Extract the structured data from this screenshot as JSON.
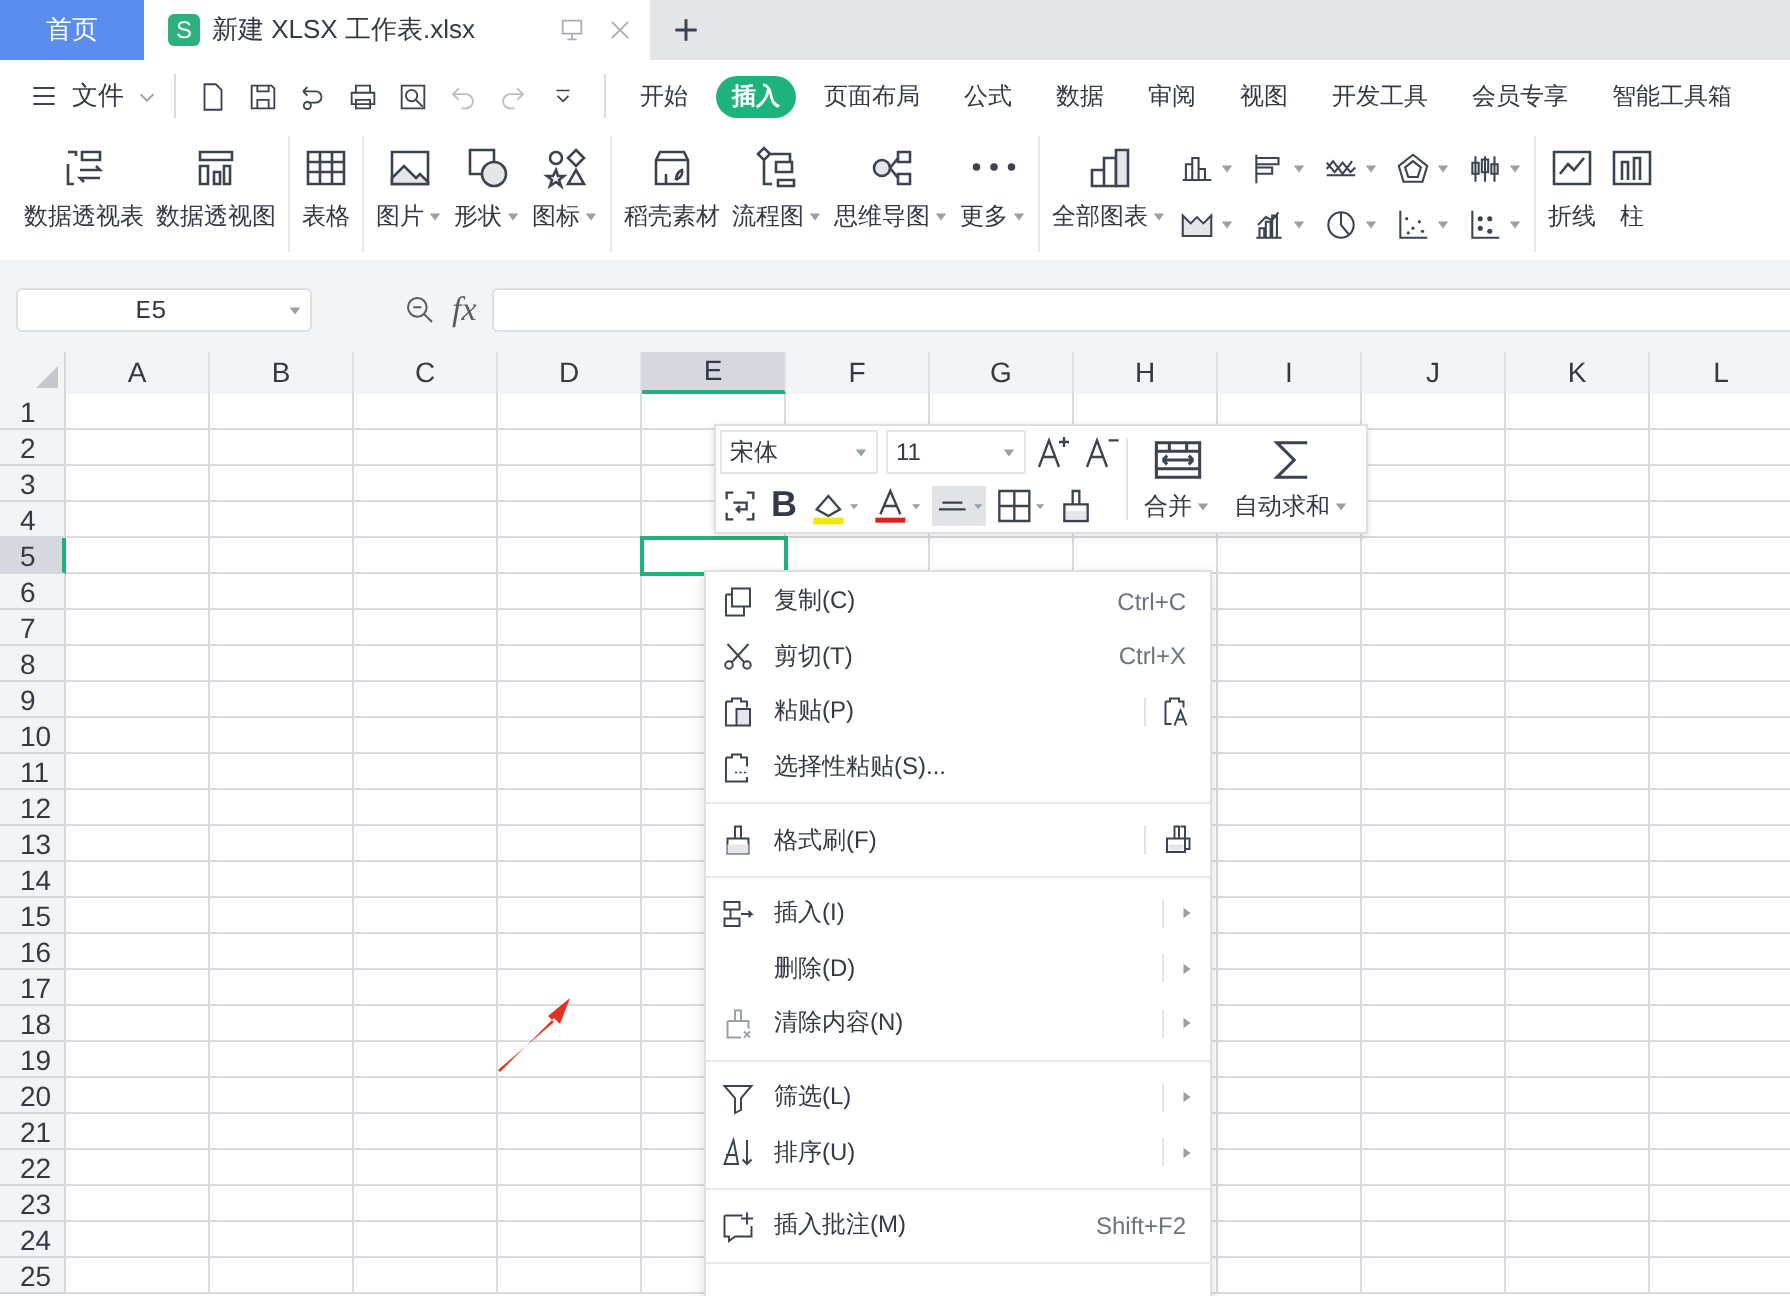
{
  "tabs": [
    {
      "kind": "home",
      "label": "首页",
      "selected": false
    },
    {
      "kind": "doc",
      "badge": "S",
      "label": "新建 XLSX 工作表.xlsx",
      "selected": true
    }
  ],
  "menu_bar": {
    "file_label": "文件",
    "quick_access": [
      {
        "disabled": false
      },
      {
        "disabled": false
      },
      {
        "disabled": false
      },
      {
        "disabled": false
      },
      {
        "disabled": false
      },
      {
        "disabled": true
      },
      {
        "disabled": true
      }
    ],
    "tabs": [
      {
        "label": "开始",
        "selected": false
      },
      {
        "label": "插入",
        "selected": true
      },
      {
        "label": "页面布局",
        "selected": false
      },
      {
        "label": "公式",
        "selected": false
      },
      {
        "label": "数据",
        "selected": false
      },
      {
        "label": "审阅",
        "selected": false
      },
      {
        "label": "视图",
        "selected": false
      },
      {
        "label": "开发工具",
        "selected": false
      },
      {
        "label": "会员专享",
        "selected": false
      },
      {
        "label": "智能工具箱",
        "selected": false
      }
    ]
  },
  "ribbon": {
    "groups": [
      {
        "items": [
          {
            "kind": "big",
            "label": "数据透视表",
            "dropdown": false
          },
          {
            "kind": "big",
            "label": "数据透视图",
            "dropdown": false
          }
        ]
      },
      {
        "items": [
          {
            "kind": "big",
            "label": "表格",
            "dropdown": false
          }
        ]
      },
      {
        "items": [
          {
            "kind": "big",
            "label": "图片",
            "dropdown": true
          },
          {
            "kind": "big",
            "label": "形状",
            "dropdown": true
          },
          {
            "kind": "big",
            "label": "图标",
            "dropdown": true
          }
        ]
      },
      {
        "items": [
          {
            "kind": "big",
            "label": "稻壳素材",
            "dropdown": false
          },
          {
            "kind": "big",
            "label": "流程图",
            "dropdown": true
          },
          {
            "kind": "big",
            "label": "思维导图",
            "dropdown": true
          },
          {
            "kind": "big",
            "label": "更多",
            "dropdown": true
          }
        ]
      },
      {
        "items": [
          {
            "kind": "big",
            "label": "全部图表",
            "dropdown": true
          },
          {
            "kind": "small",
            "dropdown": true
          },
          {
            "kind": "small",
            "dropdown": true
          },
          {
            "kind": "small",
            "dropdown": true
          },
          {
            "kind": "small",
            "dropdown": true
          },
          {
            "kind": "small",
            "dropdown": true
          },
          {
            "kind": "small",
            "dropdown": true
          },
          {
            "kind": "small",
            "dropdown": true
          },
          {
            "kind": "small",
            "dropdown": true
          },
          {
            "kind": "small",
            "dropdown": true
          },
          {
            "kind": "small",
            "dropdown": true
          }
        ]
      },
      {
        "items": [
          {
            "kind": "big",
            "label": "折线",
            "dropdown": false
          },
          {
            "kind": "big",
            "label": "柱",
            "dropdown": false
          }
        ]
      }
    ]
  },
  "formula_bar": {
    "name_box": "E5",
    "fx": "fx"
  },
  "sheet": {
    "columns": [
      {
        "label": "A",
        "selected": false
      },
      {
        "label": "B",
        "selected": false
      },
      {
        "label": "C",
        "selected": false
      },
      {
        "label": "D",
        "selected": false
      },
      {
        "label": "E",
        "selected": true
      },
      {
        "label": "F",
        "selected": false
      },
      {
        "label": "G",
        "selected": false
      },
      {
        "label": "H",
        "selected": false
      },
      {
        "label": "I",
        "selected": false
      },
      {
        "label": "J",
        "selected": false
      },
      {
        "label": "K",
        "selected": false
      },
      {
        "label": "L",
        "selected": false
      }
    ],
    "rows": [
      {
        "label": "1",
        "selected": false
      },
      {
        "label": "2",
        "selected": false
      },
      {
        "label": "3",
        "selected": false
      },
      {
        "label": "4",
        "selected": false
      },
      {
        "label": "5",
        "selected": true
      },
      {
        "label": "6",
        "selected": false
      },
      {
        "label": "7",
        "selected": false
      },
      {
        "label": "8",
        "selected": false
      },
      {
        "label": "9",
        "selected": false
      },
      {
        "label": "10",
        "selected": false
      },
      {
        "label": "11",
        "selected": false
      },
      {
        "label": "12",
        "selected": false
      },
      {
        "label": "13",
        "selected": false
      },
      {
        "label": "14",
        "selected": false
      },
      {
        "label": "15",
        "selected": false
      },
      {
        "label": "16",
        "selected": false
      },
      {
        "label": "17",
        "selected": false
      },
      {
        "label": "18",
        "selected": false
      },
      {
        "label": "19",
        "selected": false
      },
      {
        "label": "20",
        "selected": false
      },
      {
        "label": "21",
        "selected": false
      },
      {
        "label": "22",
        "selected": false
      },
      {
        "label": "23",
        "selected": false
      },
      {
        "label": "24",
        "selected": false
      },
      {
        "label": "25",
        "selected": false
      }
    ]
  },
  "mini_toolbar": {
    "font": "宋体",
    "size": "11",
    "bold": "B",
    "align_selected": true,
    "merge": "合并",
    "autosum": "自动求和"
  },
  "context_menu": {
    "items": [
      {
        "label": "复制(C)",
        "shortcut": "Ctrl+C",
        "submenu": false,
        "divider_before": false,
        "side_button": false
      },
      {
        "label": "剪切(T)",
        "shortcut": "Ctrl+X",
        "submenu": false,
        "divider_before": false,
        "side_button": false
      },
      {
        "label": "粘贴(P)",
        "submenu": false,
        "divider_before": false,
        "side_button": true
      },
      {
        "label": "选择性粘贴(S)...",
        "submenu": false,
        "divider_before": false,
        "side_button": false
      },
      {
        "label": "格式刷(F)",
        "submenu": false,
        "divider_before": true,
        "side_button": true
      },
      {
        "label": "插入(I)",
        "submenu": true,
        "divider_before": true,
        "side_button": false
      },
      {
        "label": "删除(D)",
        "submenu": true,
        "divider_before": false,
        "side_button": false
      },
      {
        "label": "清除内容(N)",
        "submenu": true,
        "divider_before": false,
        "side_button": false
      },
      {
        "label": "筛选(L)",
        "submenu": true,
        "divider_before": true,
        "side_button": false
      },
      {
        "label": "排序(U)",
        "submenu": true,
        "divider_before": false,
        "side_button": false
      },
      {
        "label": "插入批注(M)",
        "shortcut": "Shift+F2",
        "submenu": false,
        "divider_before": true,
        "side_button": false
      }
    ]
  }
}
